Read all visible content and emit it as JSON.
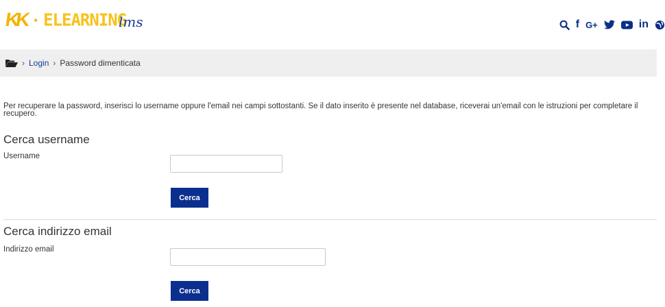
{
  "header": {
    "logo": {
      "brand": "KK",
      "dot": "·",
      "text": "ELEARNING",
      "suffix": "lms"
    },
    "social_icons": [
      "search-icon",
      "facebook-icon",
      "google-plus-icon",
      "twitter-icon",
      "youtube-icon",
      "linkedin-icon",
      "globe-icon"
    ],
    "social_labels": {
      "facebook": "f",
      "google_plus": "G+",
      "linkedin": "in"
    }
  },
  "breadcrumb": {
    "sep": "›",
    "login": "Login",
    "current": "Password dimenticata"
  },
  "intro": "Per recuperare la password, inserisci lo username oppure l'email nei campi sottostanti. Se il dato inserito è presente nel database, riceverai un'email con le istruzioni per completare il recupero.",
  "username_section": {
    "title": "Cerca username",
    "label": "Username",
    "value": "",
    "button": "Cerca"
  },
  "email_section": {
    "title": "Cerca indirizzo email",
    "label": "Indirizzo email",
    "value": "",
    "button": "Cerca"
  },
  "colors": {
    "brand_yellow": "#f4b400",
    "brand_blue": "#0a2f8f",
    "link": "#0a3d9a",
    "breadcrumb_bg": "#efefef"
  }
}
